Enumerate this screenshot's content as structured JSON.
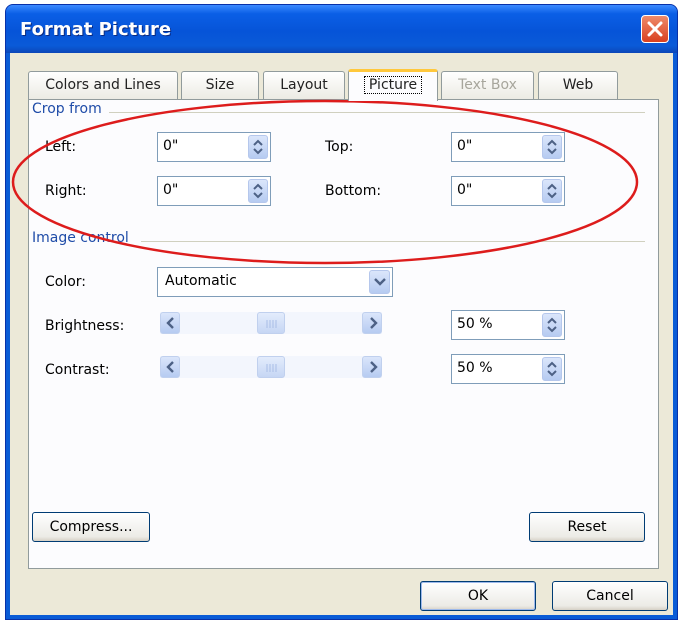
{
  "window": {
    "title": "Format Picture"
  },
  "tabs": [
    {
      "label": "Colors and Lines",
      "selected": false,
      "disabled": false
    },
    {
      "label": "Size",
      "selected": false,
      "disabled": false
    },
    {
      "label": "Layout",
      "selected": false,
      "disabled": false
    },
    {
      "label": "Picture",
      "selected": true,
      "disabled": false
    },
    {
      "label": "Text Box",
      "selected": false,
      "disabled": true
    },
    {
      "label": "Web",
      "selected": false,
      "disabled": false
    }
  ],
  "crop": {
    "section_label": "Crop from",
    "left_label": "Left:",
    "left_value": "0\"",
    "right_label": "Right:",
    "right_value": "0\"",
    "top_label": "Top:",
    "top_value": "0\"",
    "bottom_label": "Bottom:",
    "bottom_value": "0\""
  },
  "image_control": {
    "section_label": "Image control",
    "color_label": "Color:",
    "color_value": "Automatic",
    "brightness_label": "Brightness:",
    "brightness_value": "50 %",
    "brightness_level": 0.5,
    "contrast_label": "Contrast:",
    "contrast_value": "50 %",
    "contrast_level": 0.5
  },
  "buttons": {
    "compress": "Compress...",
    "reset": "Reset",
    "ok": "OK",
    "cancel": "Cancel"
  },
  "colors": {
    "titlebar": "#0a5cd6",
    "section_label": "#1f4ca8",
    "annotation_ellipse": "#dd1c1c",
    "close_button": "#d94020"
  }
}
